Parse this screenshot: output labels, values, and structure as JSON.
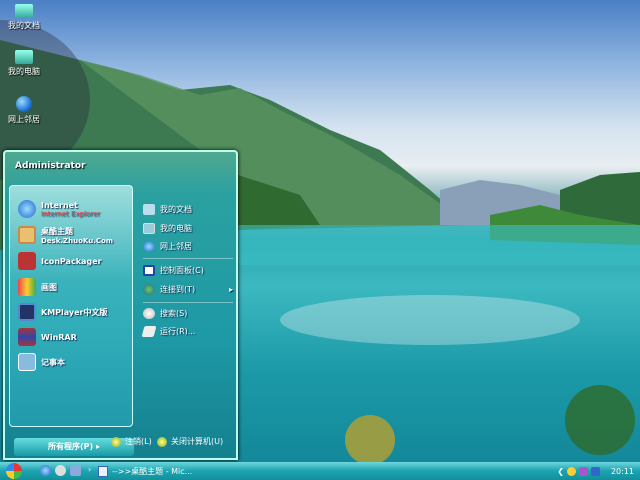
{
  "desktop": {
    "icons": [
      {
        "label": "我的文档",
        "icon": "folder-documents-icon"
      },
      {
        "label": "我的电脑",
        "icon": "computer-icon"
      },
      {
        "label": "网上邻居",
        "icon": "network-globe-icon"
      }
    ]
  },
  "start_menu": {
    "user": "Administrator",
    "pinned": [
      {
        "title": "Internet",
        "subtitle": "Internet Explorer",
        "icon": "internet-explorer-icon"
      },
      {
        "title": "桌酷主题",
        "subtitle": "Desk.ZhuoKu.Com",
        "icon": "zhuoku-theme-icon"
      },
      {
        "title": "IconPackager",
        "icon": "iconpackager-icon"
      },
      {
        "title": "画图",
        "icon": "paint-icon"
      },
      {
        "title": "KMPlayer中文版",
        "icon": "kmplayer-icon"
      },
      {
        "title": "WinRAR",
        "icon": "winrar-icon"
      },
      {
        "title": "记事本",
        "icon": "notepad-icon"
      }
    ],
    "all_programs": "所有程序(P)",
    "right": [
      {
        "label": "我的文档",
        "icon": "my-documents-icon"
      },
      {
        "label": "我的电脑",
        "icon": "my-computer-icon"
      },
      {
        "label": "网上邻居",
        "icon": "network-icon"
      },
      {
        "label": "控制面板(C)",
        "icon": "control-panel-icon"
      },
      {
        "label": "连接到(T)",
        "icon": "connect-to-icon"
      },
      {
        "label": "搜索(S)",
        "icon": "search-icon"
      },
      {
        "label": "运行(R)...",
        "icon": "run-icon"
      }
    ],
    "logoff": "注销(L)",
    "shutdown": "关闭计算机(U)"
  },
  "taskbar": {
    "task": "-->>桌酷主题 - Mic...",
    "clock": "20:11"
  },
  "colors": {
    "taskbar": "#1ba3b0",
    "menu": "#1e9aa6"
  }
}
